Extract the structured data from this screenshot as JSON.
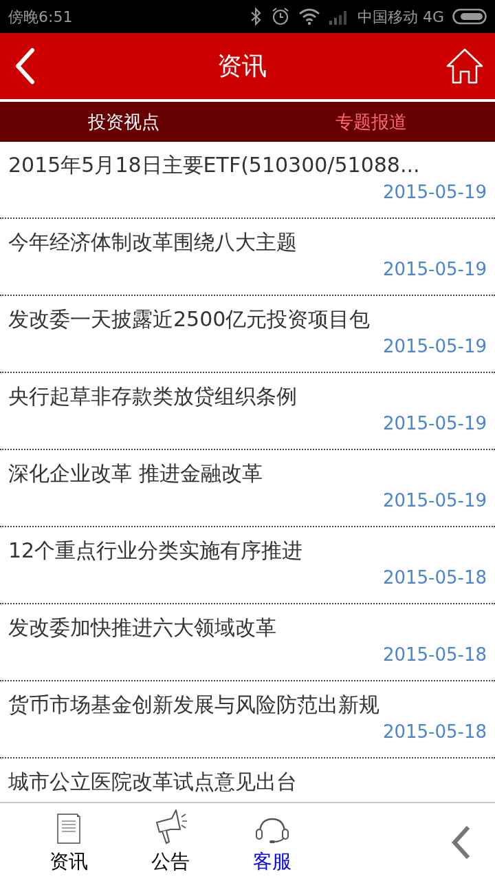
{
  "status_bar": {
    "time": "傍晚6:51",
    "carrier": "中国移动 4G"
  },
  "header": {
    "title": "资讯"
  },
  "tabs": [
    {
      "label": "投资视点",
      "selected": true
    },
    {
      "label": "专题报道",
      "selected": false
    }
  ],
  "articles": [
    {
      "title": "2015年5月18日主要ETF(510300/51088...",
      "date": "2015-05-19"
    },
    {
      "title": "今年经济体制改革围绕八大主题",
      "date": "2015-05-19"
    },
    {
      "title": "发改委一天披露近2500亿元投资项目包",
      "date": "2015-05-19"
    },
    {
      "title": "央行起草非存款类放贷组织条例",
      "date": "2015-05-19"
    },
    {
      "title": "深化企业改革 推进金融改革",
      "date": "2015-05-19"
    },
    {
      "title": "12个重点行业分类实施有序推进",
      "date": "2015-05-18"
    },
    {
      "title": "发改委加快推进六大领域改革",
      "date": "2015-05-18"
    },
    {
      "title": "货币市场基金创新发展与风险防范出新规",
      "date": "2015-05-18"
    },
    {
      "title": "城市公立医院改革试点意见出台"
    }
  ],
  "bottom_nav": [
    {
      "label": "资讯",
      "kind": "document",
      "selected": false
    },
    {
      "label": "公告",
      "kind": "megaphone",
      "selected": false
    },
    {
      "label": "客服",
      "kind": "headset",
      "selected": true
    }
  ]
}
